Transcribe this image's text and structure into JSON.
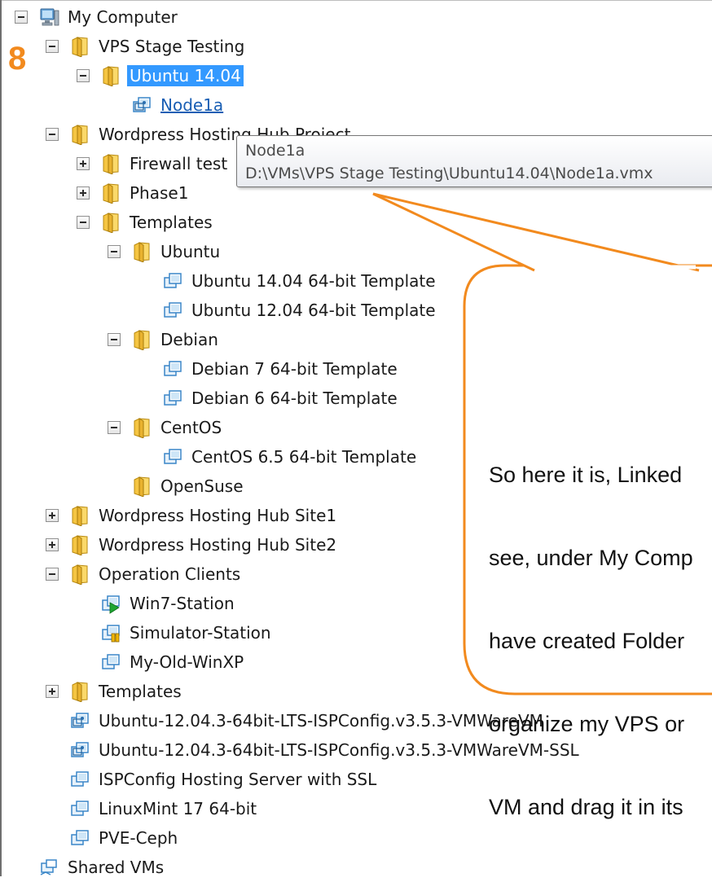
{
  "step_badge": "8",
  "tree": [
    {
      "label": "My Computer",
      "icon": "computer-icon",
      "toggle": "minus"
    },
    {
      "label": "VPS Stage Testing",
      "icon": "folder-icon",
      "toggle": "minus"
    },
    {
      "label": "Ubuntu 14.04",
      "icon": "folder-icon",
      "toggle": "minus",
      "selected": true
    },
    {
      "label": "Node1a",
      "icon": "vm-linked-icon",
      "toggle": "none",
      "link": true
    },
    {
      "label": "Wordpress Hosting Hub Project",
      "icon": "folder-icon",
      "toggle": "minus"
    },
    {
      "label": "Firewall test",
      "icon": "folder-icon",
      "toggle": "plus"
    },
    {
      "label": "Phase1",
      "icon": "folder-icon",
      "toggle": "plus"
    },
    {
      "label": "Templates",
      "icon": "folder-icon",
      "toggle": "minus"
    },
    {
      "label": "Ubuntu",
      "icon": "folder-icon",
      "toggle": "minus"
    },
    {
      "label": "Ubuntu 14.04 64-bit Template",
      "icon": "vm-template-icon",
      "toggle": "none"
    },
    {
      "label": "Ubuntu 12.04 64-bit Template",
      "icon": "vm-template-icon",
      "toggle": "none"
    },
    {
      "label": "Debian",
      "icon": "folder-icon",
      "toggle": "minus"
    },
    {
      "label": "Debian 7 64-bit Template",
      "icon": "vm-template-icon",
      "toggle": "none"
    },
    {
      "label": "Debian 6 64-bit Template",
      "icon": "vm-template-icon",
      "toggle": "none"
    },
    {
      "label": "CentOS",
      "icon": "folder-icon",
      "toggle": "minus"
    },
    {
      "label": "CentOS 6.5 64-bit Template",
      "icon": "vm-template-icon",
      "toggle": "none"
    },
    {
      "label": "OpenSuse",
      "icon": "folder-icon",
      "toggle": "none"
    },
    {
      "label": "Wordpress Hosting Hub Site1",
      "icon": "folder-icon",
      "toggle": "plus"
    },
    {
      "label": "Wordpress Hosting Hub Site2",
      "icon": "folder-icon",
      "toggle": "plus"
    },
    {
      "label": "Operation Clients",
      "icon": "folder-icon",
      "toggle": "minus"
    },
    {
      "label": "Win7-Station",
      "icon": "vm-running-icon",
      "toggle": "none"
    },
    {
      "label": "Simulator-Station",
      "icon": "vm-suspended-icon",
      "toggle": "none"
    },
    {
      "label": "My-Old-WinXP",
      "icon": "vm-template-icon",
      "toggle": "none"
    },
    {
      "label": "Templates",
      "icon": "folder-icon",
      "toggle": "plus"
    },
    {
      "label": "Ubuntu-12.04.3-64bit-LTS-ISPConfig.v3.5.3-VMWareVM",
      "icon": "vm-linked-icon",
      "toggle": "none"
    },
    {
      "label": "Ubuntu-12.04.3-64bit-LTS-ISPConfig.v3.5.3-VMWareVM-SSL",
      "icon": "vm-linked-icon",
      "toggle": "none"
    },
    {
      "label": "ISPConfig Hosting Server with SSL",
      "icon": "vm-template-icon",
      "toggle": "none"
    },
    {
      "label": "LinuxMint 17 64-bit",
      "icon": "vm-template-icon",
      "toggle": "none"
    },
    {
      "label": "PVE-Ceph",
      "icon": "vm-template-icon",
      "toggle": "none"
    },
    {
      "label": "Shared VMs",
      "icon": "shared-vms-icon",
      "toggle": "none"
    }
  ],
  "tooltip": {
    "title": "Node1a",
    "path": "D:\\VMs\\VPS Stage Testing\\Ubuntu14.04\\Node1a.vmx"
  },
  "callout": {
    "lines": [
      "So here it is, Linked",
      "see, under My Comp",
      "have created Folder",
      "organize my VPS or",
      "VM and drag it in its"
    ]
  },
  "colors": {
    "selection": "#3399ff",
    "callout_border": "#f28a1e",
    "badge": "#f28a1e"
  }
}
